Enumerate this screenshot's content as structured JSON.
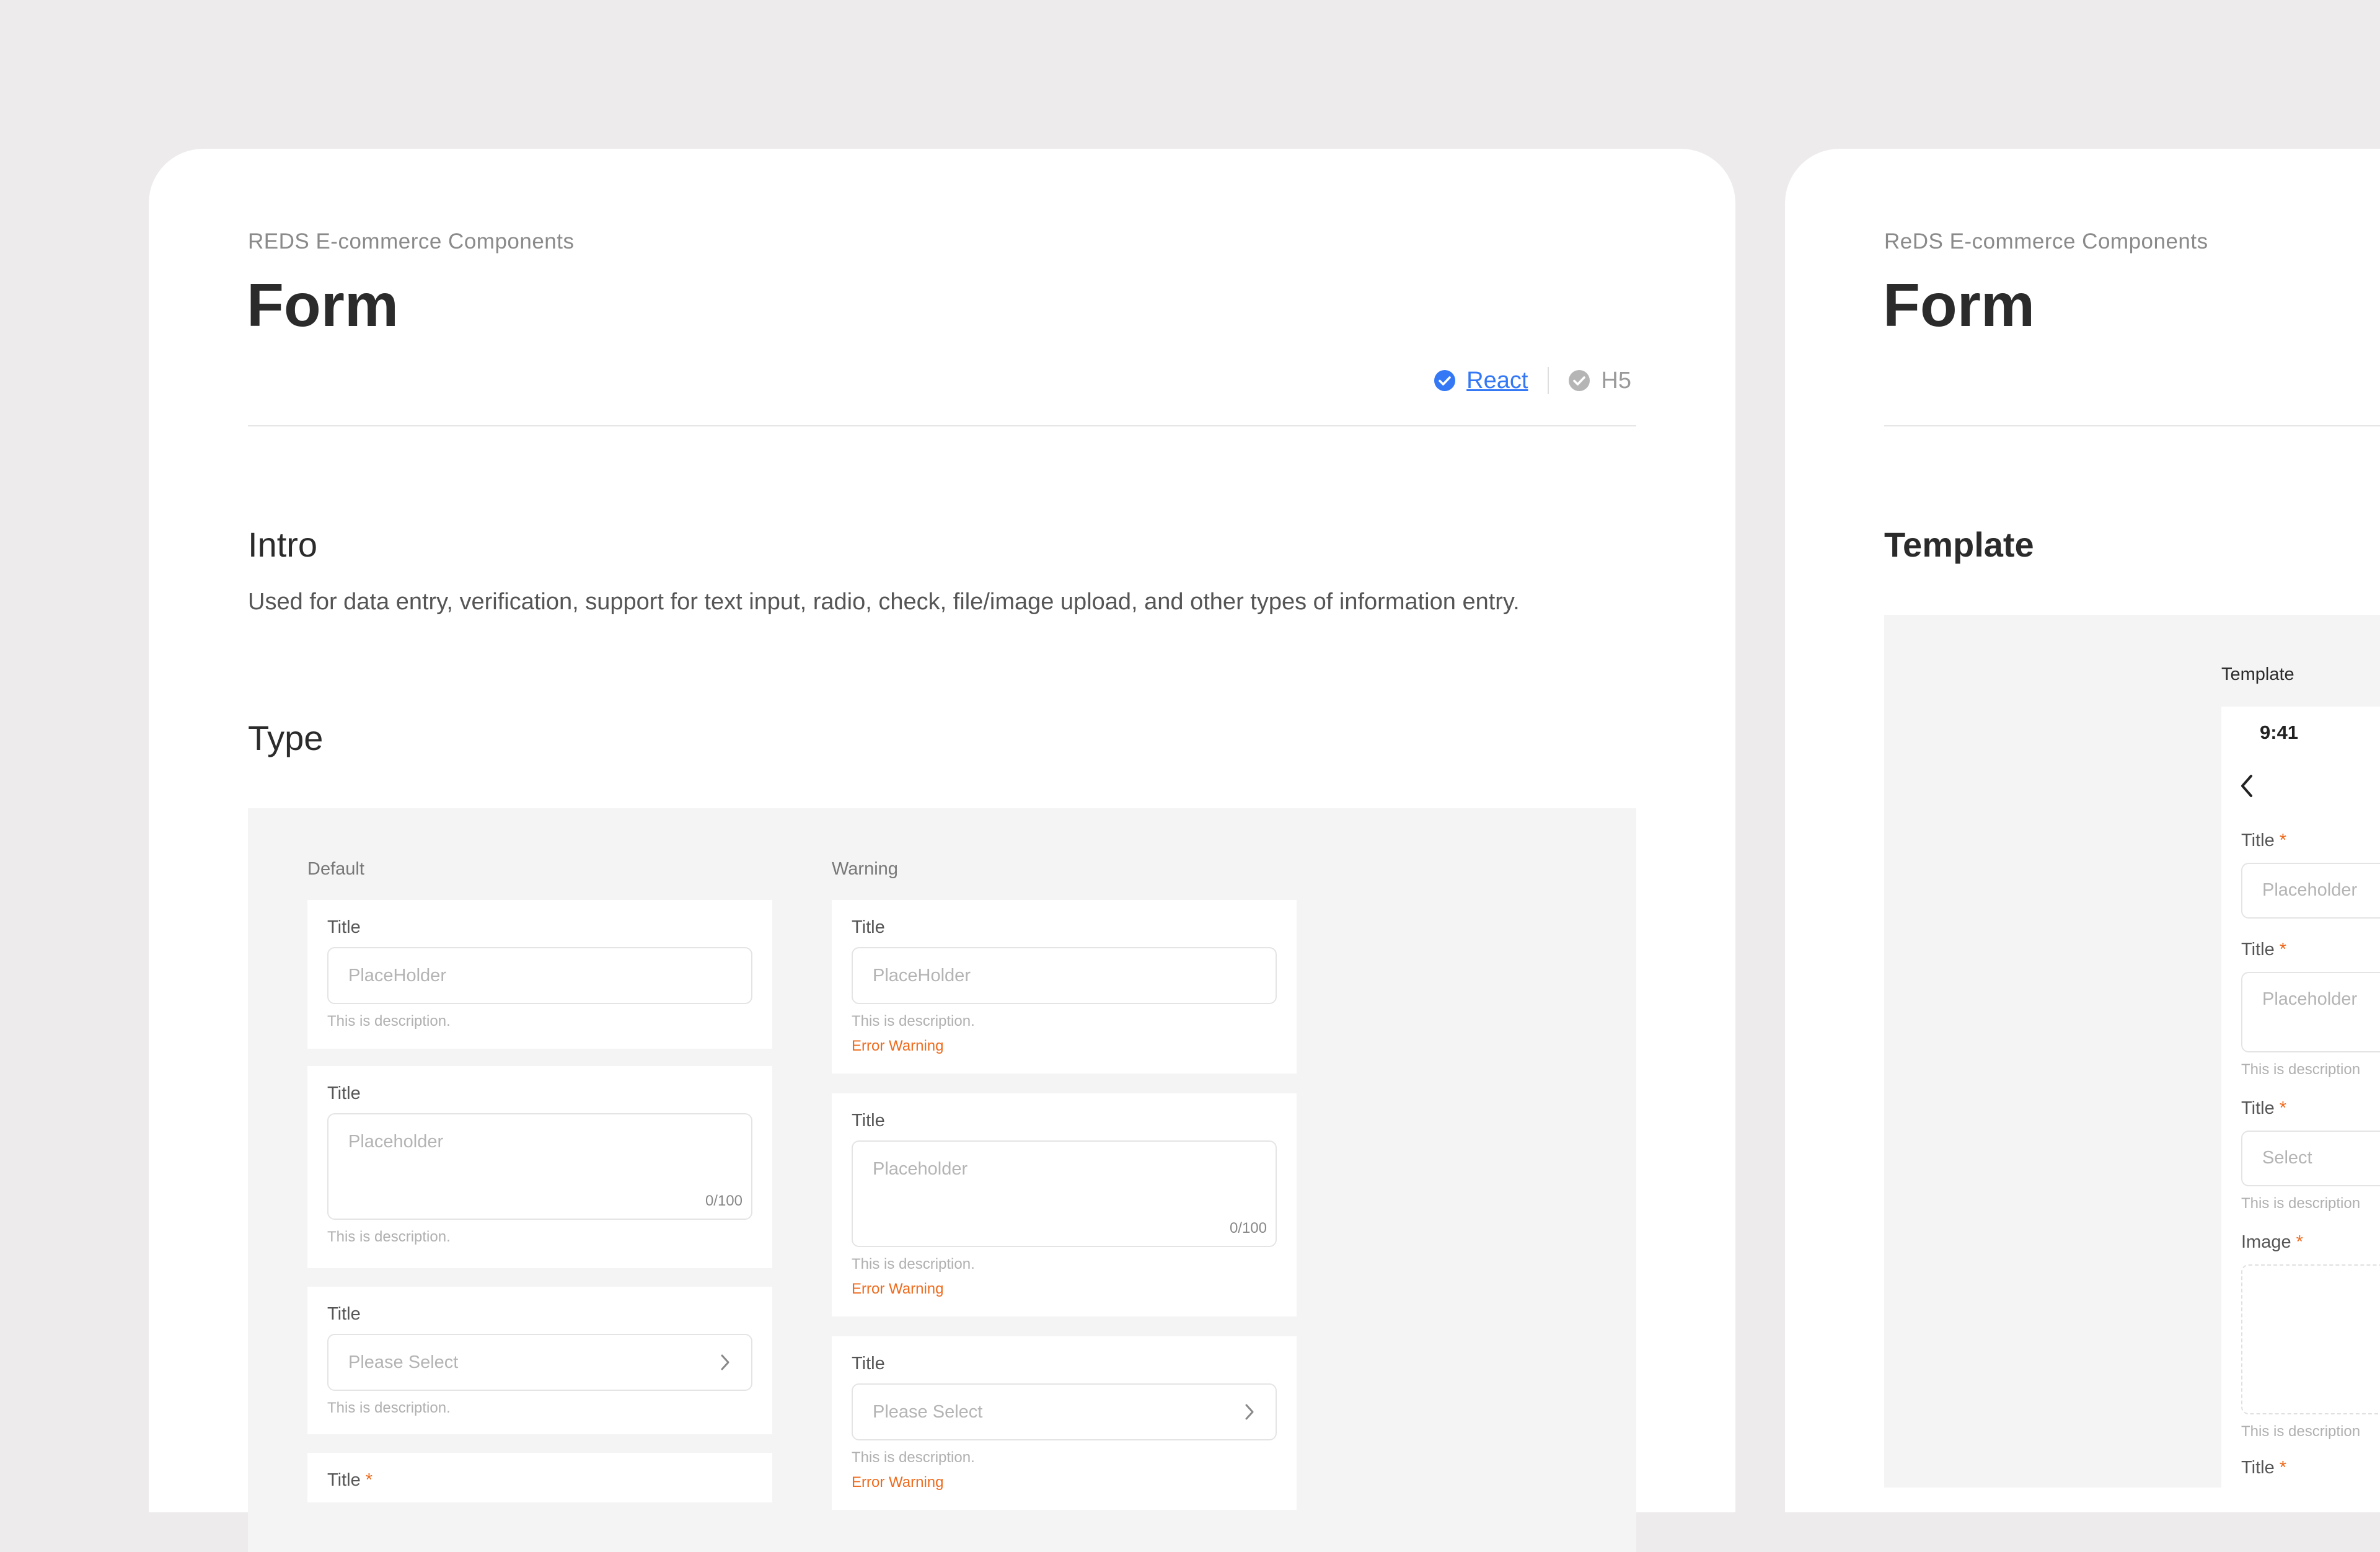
{
  "left": {
    "subtitle": "REDS E-commerce Components",
    "title": "Form",
    "versions": {
      "react": "React",
      "h5": "H5"
    },
    "intro_heading": "Intro",
    "intro_text": "Used for data entry, verification, support for text input, radio, check, file/image upload, and other types of information entry.",
    "type_heading": "Type",
    "columns": {
      "default": {
        "label": "Default",
        "input": {
          "title": "Title",
          "placeholder": "PlaceHolder",
          "desc": "This is description."
        },
        "textarea": {
          "title": "Title",
          "placeholder": "Placeholder",
          "counter": "0/100",
          "desc": "This is description."
        },
        "select": {
          "title": "Title",
          "placeholder": "Please Select",
          "desc": "This is description."
        },
        "required": {
          "title": "Title",
          "asterisk": "*"
        }
      },
      "warning": {
        "label": "Warning",
        "input": {
          "title": "Title",
          "placeholder": "PlaceHolder",
          "desc": "This is description.",
          "error": "Error Warning"
        },
        "textarea": {
          "title": "Title",
          "placeholder": "Placeholder",
          "counter": "0/100",
          "desc": "This is description.",
          "error": "Error Warning"
        },
        "select": {
          "title": "Title",
          "placeholder": "Please Select",
          "desc": "This is description.",
          "error": "Error Warning"
        }
      }
    }
  },
  "right": {
    "subtitle": "ReDS E-commerce Components",
    "title": "Form",
    "template_heading": "Template",
    "template_label": "Template",
    "phone": {
      "time": "9:41",
      "fields": [
        {
          "title": "Title",
          "asterisk": "*",
          "placeholder": "Placeholder"
        },
        {
          "title": "Title",
          "asterisk": "*",
          "placeholder": "Placeholder",
          "desc": "This is description"
        },
        {
          "title": "Title",
          "asterisk": "*",
          "placeholder": "Select",
          "desc": "This is description"
        },
        {
          "title": "Image",
          "asterisk": "*",
          "desc": "This is description"
        },
        {
          "title": "Title",
          "asterisk": "*"
        }
      ]
    }
  },
  "colors": {
    "accent": "#3478f6",
    "error": "#ee6b1d",
    "background": "#edebeb"
  }
}
